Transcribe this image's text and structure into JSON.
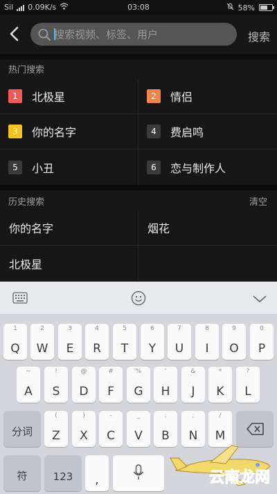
{
  "status_bar": {
    "carrier": "Sil",
    "network": "0.09K/s",
    "time": "03:08",
    "battery": "58%"
  },
  "header": {
    "search_placeholder": "搜索视频、标签、用户",
    "search_button": "搜索"
  },
  "hot": {
    "title": "热门搜索",
    "items": [
      {
        "rank": "1",
        "text": "北极星",
        "color": "#f05a5a"
      },
      {
        "rank": "2",
        "text": "情侣",
        "color": "#f5834c"
      },
      {
        "rank": "3",
        "text": "你的名字",
        "color": "#f7c21c"
      },
      {
        "rank": "4",
        "text": "费启鸣",
        "color": "#3a3a3a"
      },
      {
        "rank": "5",
        "text": "小丑",
        "color": "#3a3a3a"
      },
      {
        "rank": "6",
        "text": "恋与制作人",
        "color": "#3a3a3a"
      }
    ]
  },
  "history": {
    "title": "历史搜索",
    "clear": "清空",
    "items": [
      "你的名字",
      "烟花",
      "北极星"
    ]
  },
  "keyboard": {
    "row1": [
      {
        "hint": "1",
        "key": "Q"
      },
      {
        "hint": "2",
        "key": "W"
      },
      {
        "hint": "3",
        "key": "E"
      },
      {
        "hint": "4",
        "key": "R"
      },
      {
        "hint": "5",
        "key": "T"
      },
      {
        "hint": "6",
        "key": "Y"
      },
      {
        "hint": "7",
        "key": "U"
      },
      {
        "hint": "8",
        "key": "I"
      },
      {
        "hint": "9",
        "key": "O"
      },
      {
        "hint": "0",
        "key": "P"
      }
    ],
    "row2": [
      {
        "hint": "~",
        "key": "A"
      },
      {
        "hint": "!",
        "key": "S"
      },
      {
        "hint": "@",
        "key": "D"
      },
      {
        "hint": "#",
        "key": "F"
      },
      {
        "hint": "%",
        "key": "G"
      },
      {
        "hint": "'",
        "key": "H"
      },
      {
        "hint": "&",
        "key": "J"
      },
      {
        "hint": "*",
        "key": "K"
      },
      {
        "hint": "?",
        "key": "L"
      }
    ],
    "row3_left": "分词",
    "row3": [
      {
        "hint": "(",
        "key": "Z"
      },
      {
        "hint": ")",
        "key": "X"
      },
      {
        "hint": "-",
        "key": "C"
      },
      {
        "hint": "_",
        "key": "V"
      },
      {
        "hint": ":",
        "key": "B"
      },
      {
        "hint": ";",
        "key": "N"
      },
      {
        "hint": "/",
        "key": "M"
      }
    ],
    "symbol_key": "符",
    "num_key": "123",
    "comma_key": ","
  },
  "watermark": "云南龙网"
}
